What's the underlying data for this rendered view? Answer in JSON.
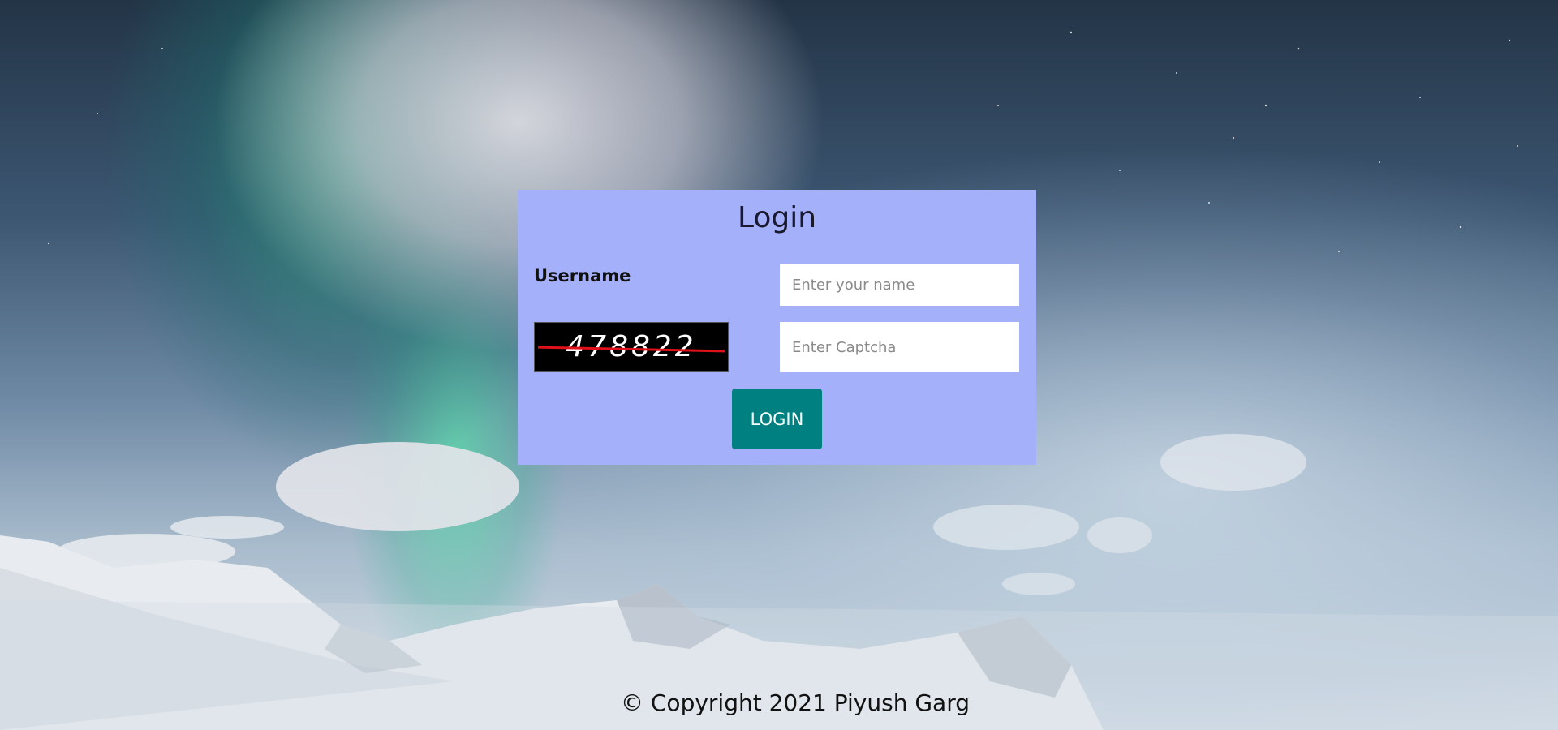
{
  "page": {
    "background": "night-sky-aurora-mountains"
  },
  "login_card": {
    "title": "Login",
    "username_label": "Username",
    "username_placeholder": "Enter your name",
    "captcha_code": "478822",
    "captcha_placeholder": "Enter Captcha",
    "login_button_label": "LOGIN",
    "card_color": "#a5b0fb",
    "button_color": "#008080"
  },
  "footer": {
    "copyright": "© Copyright 2021 Piyush Garg"
  }
}
